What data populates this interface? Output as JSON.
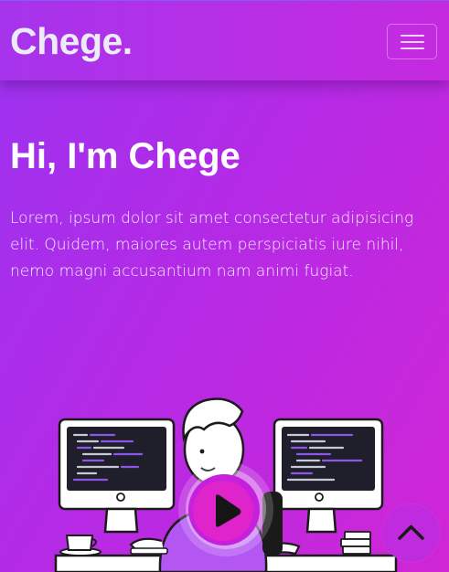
{
  "navbar": {
    "brand": "Chege.",
    "menu_icon": "hamburger-menu-icon"
  },
  "hero": {
    "title": "Hi, I'm Chege",
    "text": "Lorem, ipsum dolor sit amet consectetur adipisicing elit. Quidem, maiores autem perspiciatis iure nihil, nemo magni accusantium nam animi fugiat."
  },
  "media": {
    "illustration_icon": "developer-at-two-monitors-illustration",
    "play_icon": "play-icon"
  },
  "scroll_top": {
    "icon": "chevron-up-icon"
  },
  "colors": {
    "background_start": "#9b33f0",
    "background_end": "#d026d6",
    "accent": "#c02be0",
    "brand_text": "#ececf6"
  }
}
